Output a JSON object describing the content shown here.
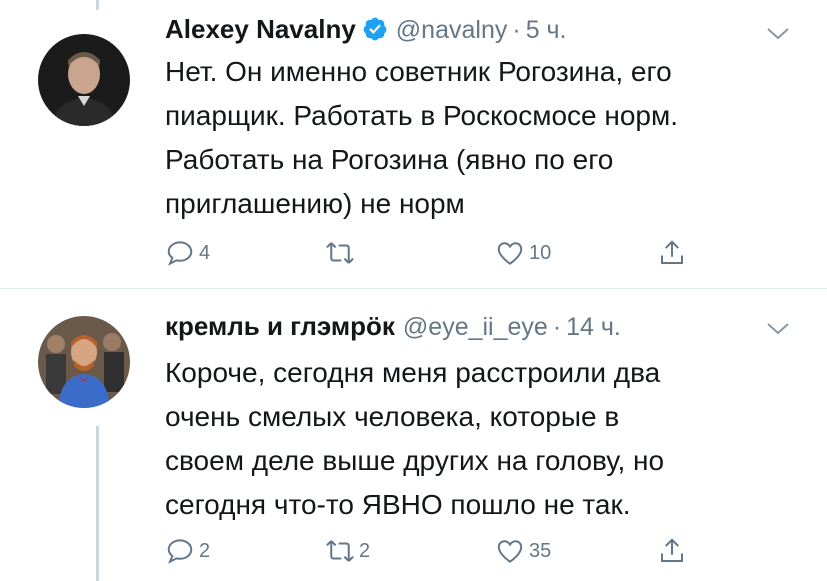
{
  "tweets": [
    {
      "name": "Alexey Navalny",
      "verified": true,
      "handle": "@navalny",
      "separator": "·",
      "time": "5 ч.",
      "text": "Нет. Он именно советник Рогозина, его\nпиарщик. Работать в Роскосмосе норм.\nРаботать на Рогозина (явно по его\nприглашению) не норм",
      "replies": "4",
      "retweets": "",
      "likes": "10",
      "icons": [
        "reply-icon",
        "retweet-icon",
        "like-icon",
        "share-icon"
      ]
    },
    {
      "name": "кремль и глэмрӧк",
      "verified": false,
      "handle": "@eye_ii_eye",
      "separator": "·",
      "time": "14 ч.",
      "text": "Короче, сегодня меня расстроили два\nочень смелых человека, которые в\nсвоем деле выше других на голову, но\nсегодня что-то ЯВНО пошло не так.",
      "replies": "2",
      "retweets": "2",
      "likes": "35",
      "icons": [
        "reply-icon",
        "retweet-icon",
        "like-icon",
        "share-icon"
      ]
    }
  ],
  "colors": {
    "text": "#14171a",
    "secondary": "#657786",
    "verified": "#1da1f2",
    "divider": "#e1e8ed",
    "thread_line": "#ccd6dd"
  }
}
